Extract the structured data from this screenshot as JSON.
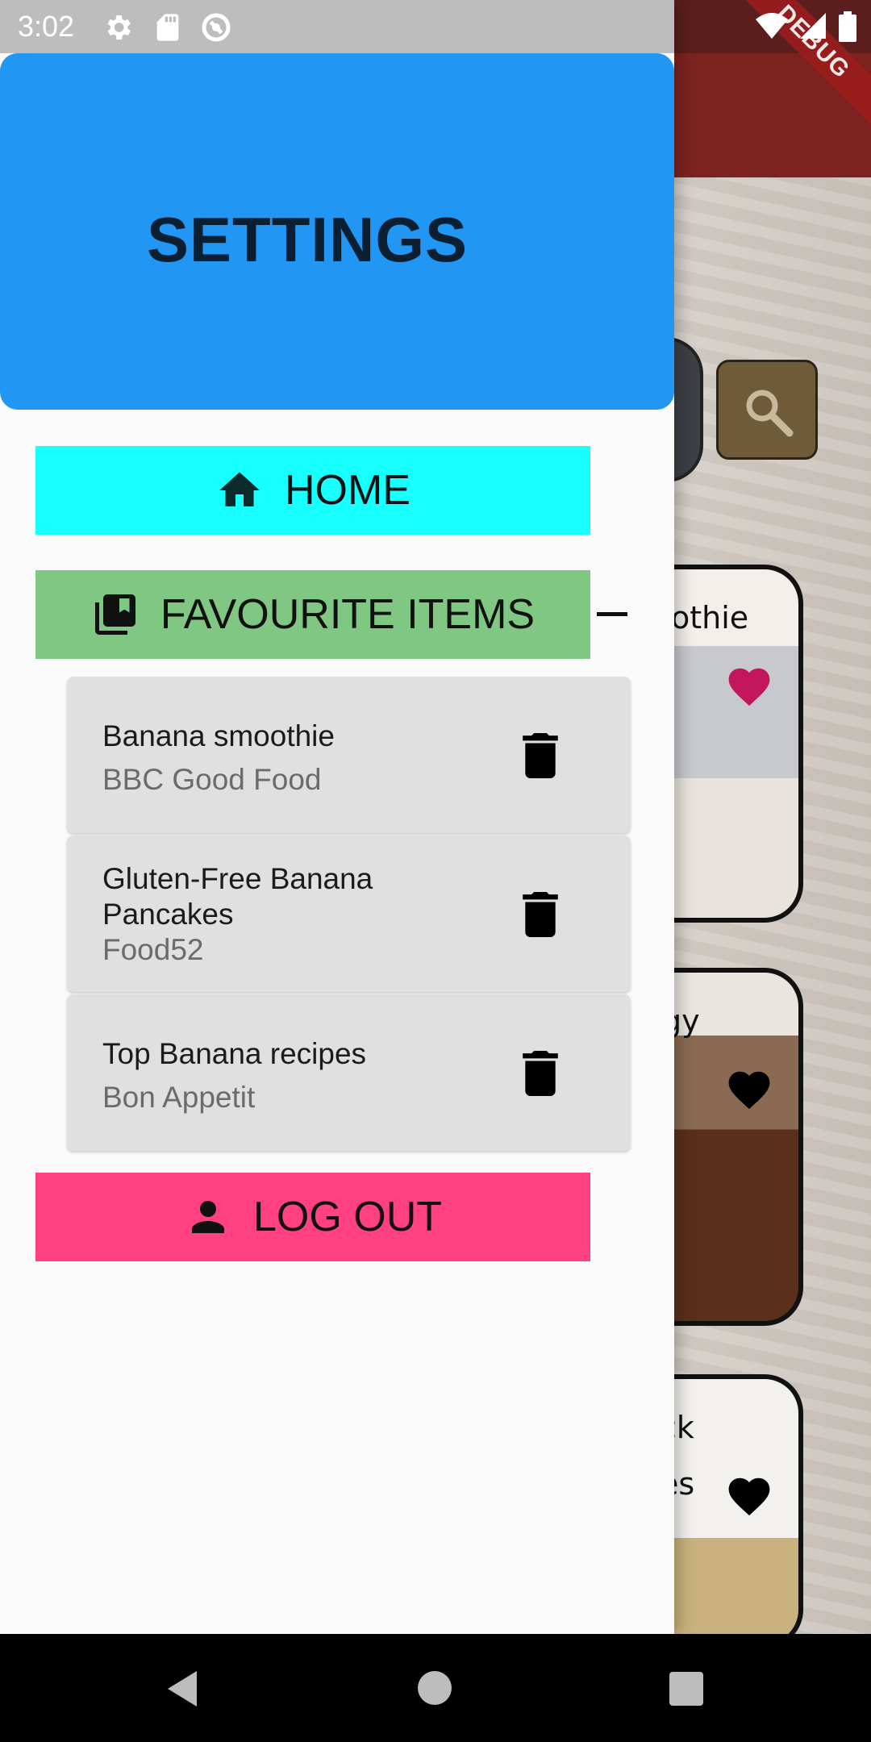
{
  "status_bar": {
    "time": "3:02",
    "icons": [
      "settings-icon",
      "sd-card-icon",
      "sync-icon",
      "wifi-icon",
      "signal-icon",
      "battery-icon"
    ]
  },
  "background": {
    "debug_banner": "DEBUG",
    "cards": [
      {
        "text": "othie",
        "heart_color": "#c2185b"
      },
      {
        "text": "rgy",
        "heart_color": "#000000"
      },
      {
        "text": "ck",
        "text2": "es",
        "heart_color": "#000000"
      }
    ]
  },
  "drawer": {
    "header": {
      "title": "SETTINGS",
      "color": "#2196f3"
    },
    "menu": {
      "home": {
        "label": "HOME",
        "icon": "home-icon",
        "color": "#18ffff"
      },
      "favourites": {
        "label": "FAVOURITE ITEMS",
        "icon": "library-icon",
        "color": "#81c784",
        "expanded": true
      },
      "logout": {
        "label": "LOG OUT",
        "icon": "person-icon",
        "color": "#ff4081"
      }
    },
    "favourite_items": [
      {
        "title": "Banana smoothie",
        "source": "BBC Good Food"
      },
      {
        "title": "Gluten-Free Banana Pancakes",
        "source": "Food52"
      },
      {
        "title": "Top Banana recipes",
        "source": "Bon Appetit"
      }
    ]
  },
  "nav_bar": {
    "buttons": [
      "back-icon",
      "home-circle-icon",
      "recents-icon"
    ]
  }
}
